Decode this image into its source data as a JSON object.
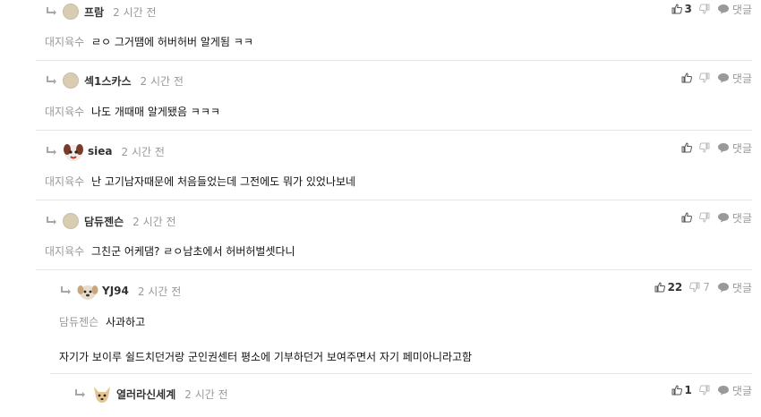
{
  "comments": [
    {
      "nickname": "프람",
      "time": "2 시간 전",
      "likes": "3",
      "reply_label": "댓글",
      "reply_to": "대지육수",
      "body": "ㄹㅇ 그거땜에 허버허버 알게됨 ㅋㅋ"
    },
    {
      "nickname": "섹1스카스",
      "time": "2 시간 전",
      "reply_label": "댓글",
      "reply_to": "대지육수",
      "body": "나도 개때매 알게됐음 ㅋㅋㅋ"
    },
    {
      "nickname": "siea",
      "time": "2 시간 전",
      "reply_label": "댓글",
      "reply_to": "대지육수",
      "body": "난 고기남자때문에 처음들었는데 그전에도 뭐가 있었나보네"
    },
    {
      "nickname": "담듀젠슨",
      "time": "2 시간 전",
      "reply_label": "댓글",
      "reply_to": "대지육수",
      "body": "그친군 어케댐? ㄹㅇ남초에서 허버허벌셋다니"
    },
    {
      "nickname": "YJ94",
      "time": "2 시간 전",
      "likes": "22",
      "dislikes": "7",
      "reply_label": "댓글",
      "reply_to": "담듀젠슨",
      "body": "사과하고",
      "body2": "자기가 보이루 쉴드치던거랑 군인권센터 평소에 기부하던거 보여주면서 자기 페미아니라고함"
    },
    {
      "nickname": "열러라신세계",
      "time": "2 시간 전",
      "likes": "1",
      "reply_label": "댓글"
    }
  ],
  "colors": {
    "avatar_blank": "#d8ccb3",
    "divider": "#e6e6e6"
  }
}
